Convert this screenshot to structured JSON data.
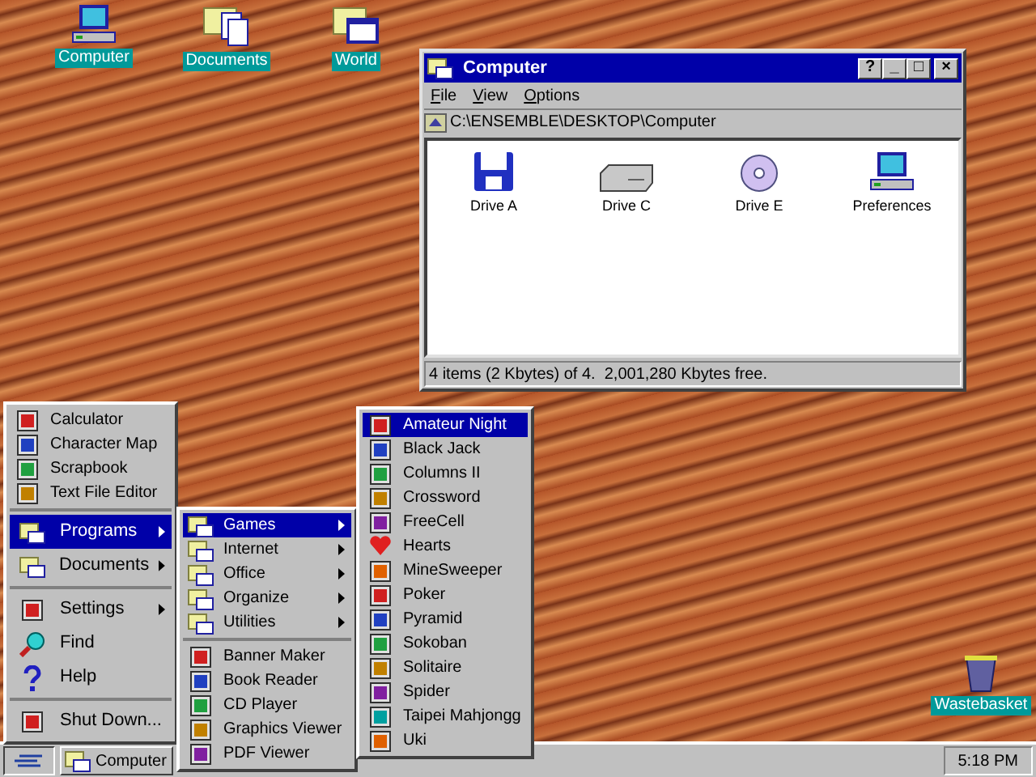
{
  "desktop_icons": [
    {
      "label": "Computer",
      "kind": "computer"
    },
    {
      "label": "Documents",
      "kind": "documents"
    },
    {
      "label": "World",
      "kind": "world"
    },
    {
      "label": "Wastebasket",
      "kind": "trash"
    }
  ],
  "window": {
    "title": "Computer",
    "title_buttons": [
      "?",
      "_",
      "□",
      "×"
    ],
    "menu": [
      "File",
      "View",
      "Options"
    ],
    "path": "C:\\ENSEMBLE\\DESKTOP\\Computer",
    "items": [
      {
        "label": "Drive A",
        "kind": "floppy"
      },
      {
        "label": "Drive C",
        "kind": "disk"
      },
      {
        "label": "Drive E",
        "kind": "cd"
      },
      {
        "label": "Preferences",
        "kind": "computer"
      }
    ],
    "status": "4 items (2 Kbytes) of 4.  2,001,280 Kbytes free."
  },
  "start_menu": {
    "groups": [
      [
        {
          "label": "Calculator",
          "kind": "app",
          "selected": false,
          "submenu": false
        },
        {
          "label": "Character Map",
          "kind": "app",
          "selected": false,
          "submenu": false
        },
        {
          "label": "Scrapbook",
          "kind": "app",
          "selected": false,
          "submenu": false
        },
        {
          "label": "Text File Editor",
          "kind": "app",
          "selected": false,
          "submenu": false
        }
      ],
      [
        {
          "label": "Programs",
          "kind": "folder",
          "selected": true,
          "submenu": true
        },
        {
          "label": "Documents",
          "kind": "folder",
          "selected": false,
          "submenu": true
        }
      ],
      [
        {
          "label": "Settings",
          "kind": "app",
          "selected": false,
          "submenu": true
        },
        {
          "label": "Find",
          "kind": "search",
          "selected": false,
          "submenu": false
        },
        {
          "label": "Help",
          "kind": "help",
          "selected": false,
          "submenu": false
        }
      ],
      [
        {
          "label": "Shut Down...",
          "kind": "app",
          "selected": false,
          "submenu": false
        }
      ]
    ]
  },
  "programs_menu": {
    "groups": [
      [
        {
          "label": "Games",
          "kind": "folder",
          "selected": true,
          "submenu": true
        },
        {
          "label": "Internet",
          "kind": "folder",
          "selected": false,
          "submenu": true
        },
        {
          "label": "Office",
          "kind": "folder",
          "selected": false,
          "submenu": true
        },
        {
          "label": "Organize",
          "kind": "folder",
          "selected": false,
          "submenu": true
        },
        {
          "label": "Utilities",
          "kind": "folder",
          "selected": false,
          "submenu": true
        }
      ],
      [
        {
          "label": "Banner Maker",
          "kind": "app",
          "selected": false,
          "submenu": false
        },
        {
          "label": "Book Reader",
          "kind": "app",
          "selected": false,
          "submenu": false
        },
        {
          "label": "CD Player",
          "kind": "app",
          "selected": false,
          "submenu": false
        },
        {
          "label": "Graphics Viewer",
          "kind": "app",
          "selected": false,
          "submenu": false
        },
        {
          "label": "PDF Viewer",
          "kind": "app",
          "selected": false,
          "submenu": false
        }
      ]
    ]
  },
  "games_menu": {
    "groups": [
      [
        {
          "label": "Amateur Night",
          "kind": "app",
          "selected": true,
          "submenu": false
        },
        {
          "label": "Black Jack",
          "kind": "app",
          "selected": false,
          "submenu": false
        },
        {
          "label": "Columns II",
          "kind": "app",
          "selected": false,
          "submenu": false
        },
        {
          "label": "Crossword",
          "kind": "app",
          "selected": false,
          "submenu": false
        },
        {
          "label": "FreeCell",
          "kind": "app",
          "selected": false,
          "submenu": false
        },
        {
          "label": "Hearts",
          "kind": "heart",
          "selected": false,
          "submenu": false
        },
        {
          "label": "MineSweeper",
          "kind": "app",
          "selected": false,
          "submenu": false
        },
        {
          "label": "Poker",
          "kind": "app",
          "selected": false,
          "submenu": false
        },
        {
          "label": "Pyramid",
          "kind": "app",
          "selected": false,
          "submenu": false
        },
        {
          "label": "Sokoban",
          "kind": "app",
          "selected": false,
          "submenu": false
        },
        {
          "label": "Solitaire",
          "kind": "app",
          "selected": false,
          "submenu": false
        },
        {
          "label": "Spider",
          "kind": "app",
          "selected": false,
          "submenu": false
        },
        {
          "label": "Taipei Mahjongg",
          "kind": "app",
          "selected": false,
          "submenu": false
        },
        {
          "label": "Uki",
          "kind": "app",
          "selected": false,
          "submenu": false
        }
      ]
    ]
  },
  "taskbar": {
    "tasks": [
      {
        "label": "Computer",
        "selected": false
      }
    ],
    "clock": "5:18 PM"
  }
}
